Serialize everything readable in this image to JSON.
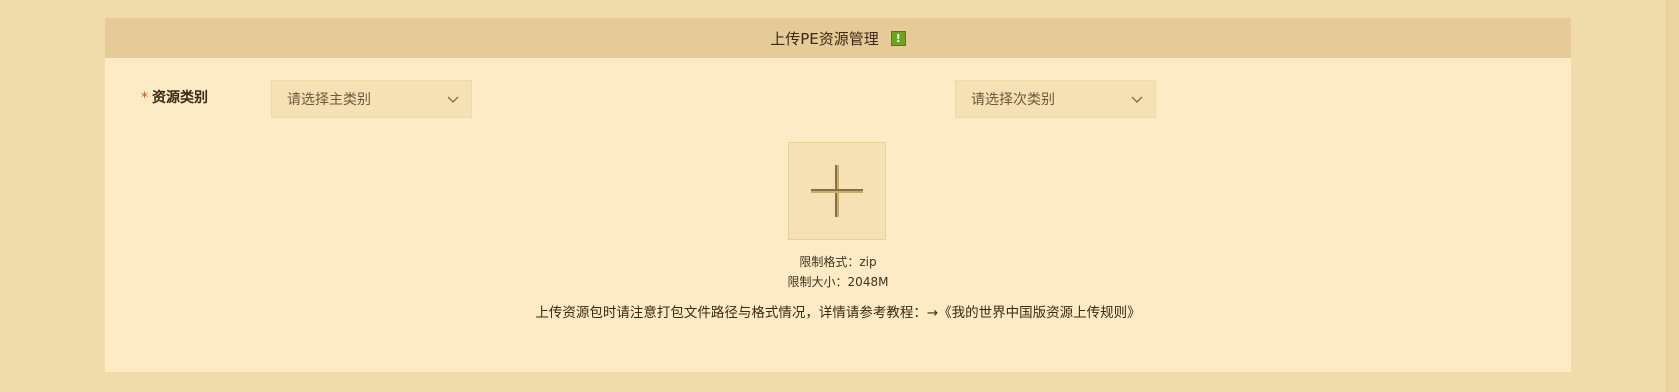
{
  "panel": {
    "title": "上传PE资源管理",
    "help_icon": "!"
  },
  "form": {
    "category_label": "资源类别",
    "required_mark": "*",
    "primary_select": {
      "placeholder": "请选择主类别"
    },
    "secondary_select": {
      "placeholder": "请选择次类别"
    }
  },
  "upload": {
    "icon": "plus-icon",
    "format_hint": "限制格式：zip",
    "size_hint": "限制大小：2048M"
  },
  "notice": {
    "text": "上传资源包时请注意打包文件路径与格式情况，详情请参考教程：",
    "link_text": "→《我的世界中国版资源上传规则》"
  },
  "colors": {
    "background": "#efdcaa",
    "panel": "#fcebc4",
    "header": "#e6ca98",
    "required": "#d2482c",
    "help_icon": "#6aa51a"
  }
}
